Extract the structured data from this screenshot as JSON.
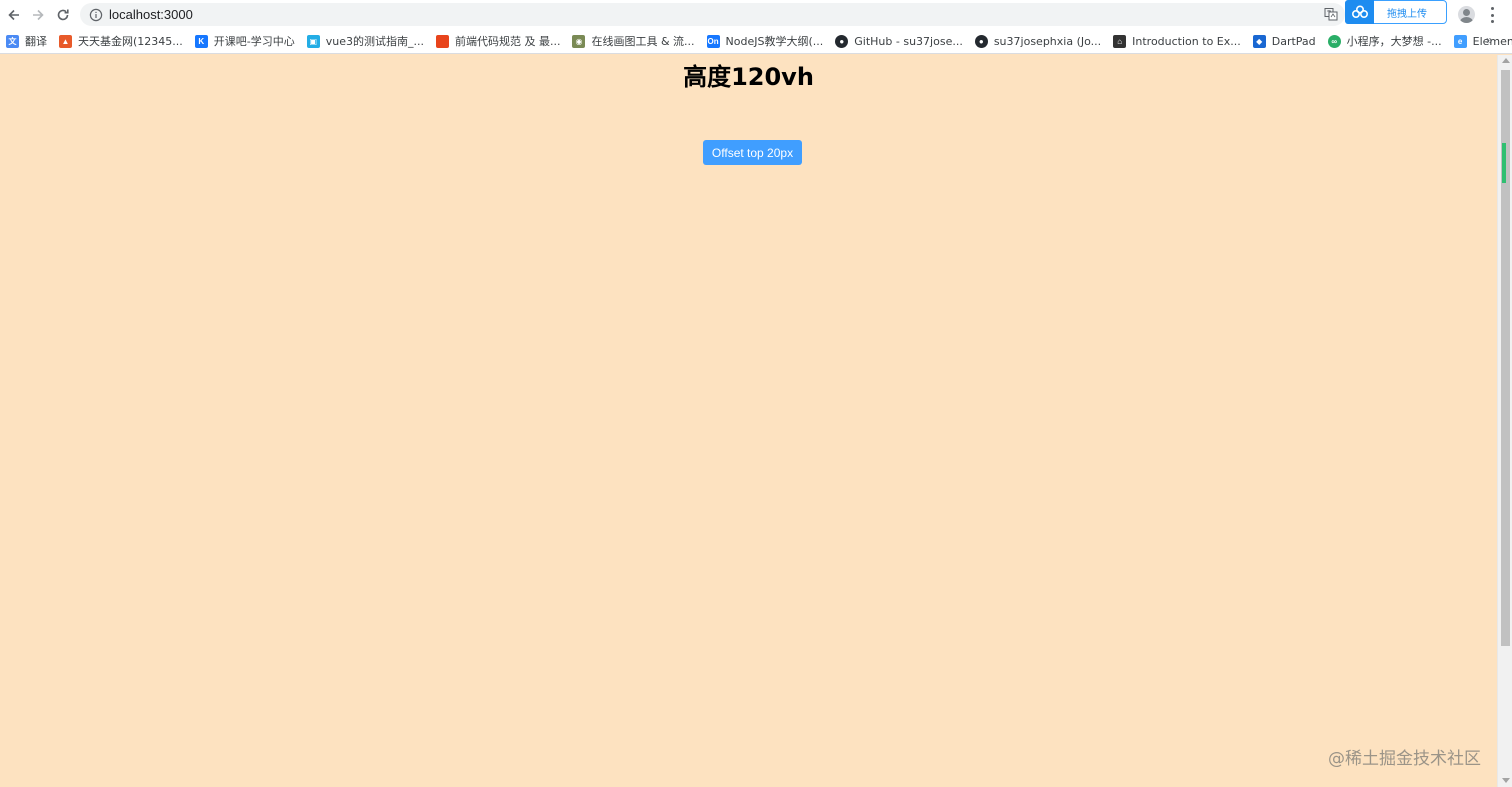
{
  "browser": {
    "url": "localhost:3000",
    "extension_upload_label": "拖拽上传",
    "more_bookmarks_glyph": "»"
  },
  "bookmarks": [
    {
      "label": "翻译",
      "icon": "translate-icon",
      "color": "#4a8af4"
    },
    {
      "label": "天天基金网(12345...",
      "icon": "fund-icon",
      "color": "#e85a2a"
    },
    {
      "label": "开课吧-学习中心",
      "icon": "kaikeba-icon",
      "color": "#1677ff"
    },
    {
      "label": "vue3的测试指南_...",
      "icon": "bilibili-icon",
      "color": "#23ade5"
    },
    {
      "label": "前端代码规范 及 最...",
      "icon": "code-icon",
      "color": "#e8441c"
    },
    {
      "label": "在线画图工具 & 流...",
      "icon": "draw-icon",
      "color": "#7a8a55"
    },
    {
      "label": "NodeJS教学大纲(...",
      "icon": "on-icon",
      "color": "#1677ff"
    },
    {
      "label": "GitHub - su37jose...",
      "icon": "github-icon",
      "color": "#24292f"
    },
    {
      "label": "su37josephxia (Jo...",
      "icon": "github-icon",
      "color": "#24292f"
    },
    {
      "label": "Introduction to Ex...",
      "icon": "express-icon",
      "color": "#333333"
    },
    {
      "label": "DartPad",
      "icon": "dartpad-icon",
      "color": "#1967d2"
    },
    {
      "label": "小程序，大梦想 -...",
      "icon": "wechat-icon",
      "color": "#2aae67"
    },
    {
      "label": "Element Plus - Th...",
      "icon": "element-icon",
      "color": "#409eff"
    }
  ],
  "page": {
    "heading": "高度120vh",
    "button_label": "Offset top 20px",
    "watermark": "@稀土掘金技术社区",
    "background": "#fde2c0",
    "button_color": "#409eff"
  }
}
